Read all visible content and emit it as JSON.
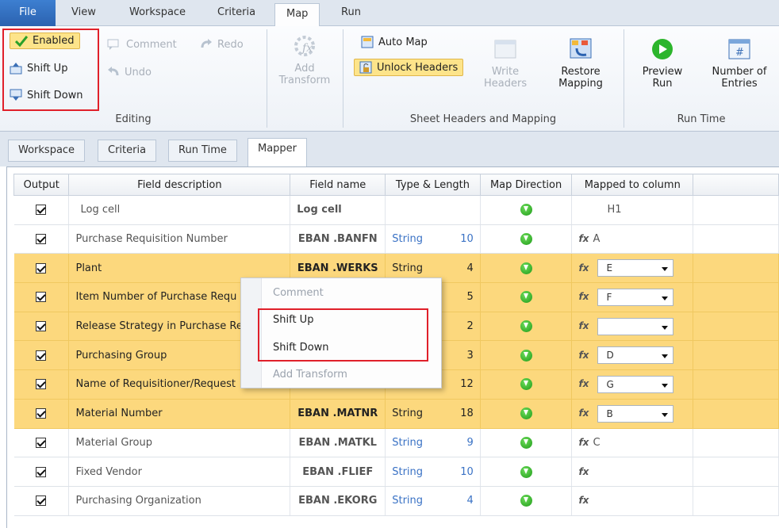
{
  "menu_tabs": {
    "file": "File",
    "view": "View",
    "workspace": "Workspace",
    "criteria": "Criteria",
    "map": "Map",
    "run": "Run"
  },
  "editing": {
    "enabled": "Enabled",
    "shift_up": "Shift Up",
    "shift_down": "Shift Down",
    "comment": "Comment",
    "undo": "Undo",
    "redo": "Redo",
    "group_label": "Editing"
  },
  "add_transform": "Add Transform",
  "sheet_headers": {
    "auto_map": "Auto Map",
    "unlock_headers": "Unlock Headers",
    "write_headers": "Write Headers",
    "restore_mapping": "Restore Mapping",
    "group_label": "Sheet Headers and Mapping"
  },
  "run_time": {
    "preview_run": "Preview Run",
    "number_of_entries": "Number of Entries",
    "group_label": "Run Time"
  },
  "doc_tabs": {
    "workspace": "Workspace",
    "criteria": "Criteria",
    "run_time": "Run Time",
    "mapper": "Mapper"
  },
  "columns": {
    "output": "Output",
    "field_description": "Field description",
    "field_name": "Field name",
    "type_length": "Type & Length",
    "map_direction": "Map Direction",
    "mapped_to_column": "Mapped to column"
  },
  "rows": [
    {
      "desc": "Log cell",
      "name": "Log cell",
      "type": "",
      "len": "",
      "mapped": "H1"
    },
    {
      "desc": "Purchase Requisition Number",
      "name": "EBAN .BANFN",
      "type": "String",
      "len": "10",
      "mapped": "A"
    },
    {
      "desc": "Plant",
      "name": "EBAN .WERKS",
      "type": "String",
      "len": "4",
      "mapped": "E"
    },
    {
      "desc": "Item Number of Purchase Requ",
      "name": "",
      "type": "",
      "len": "5",
      "mapped": "F"
    },
    {
      "desc": "Release Strategy in Purchase Re",
      "name": "",
      "type": "",
      "len": "2",
      "mapped": ""
    },
    {
      "desc": "Purchasing Group",
      "name": "",
      "type": "",
      "len": "3",
      "mapped": "D"
    },
    {
      "desc": "Name of Requisitioner/Request",
      "name": "",
      "type": "",
      "len": "12",
      "mapped": "G"
    },
    {
      "desc": "Material Number",
      "name": "EBAN .MATNR",
      "type": "String",
      "len": "18",
      "mapped": "B"
    },
    {
      "desc": "Material Group",
      "name": "EBAN .MATKL",
      "type": "String",
      "len": "9",
      "mapped": "C"
    },
    {
      "desc": "Fixed Vendor",
      "name": "EBAN .FLIEF",
      "type": "String",
      "len": "10",
      "mapped": ""
    },
    {
      "desc": "Purchasing Organization",
      "name": "EBAN .EKORG",
      "type": "String",
      "len": "4",
      "mapped": ""
    }
  ],
  "context_menu": {
    "comment": "Comment",
    "shift_up": "Shift Up",
    "shift_down": "Shift Down",
    "add_transform": "Add Transform"
  },
  "colors": {
    "selected_row": "#fcd87d",
    "highlight_red": "#e0202a",
    "accent_blue": "#2b62b0"
  }
}
